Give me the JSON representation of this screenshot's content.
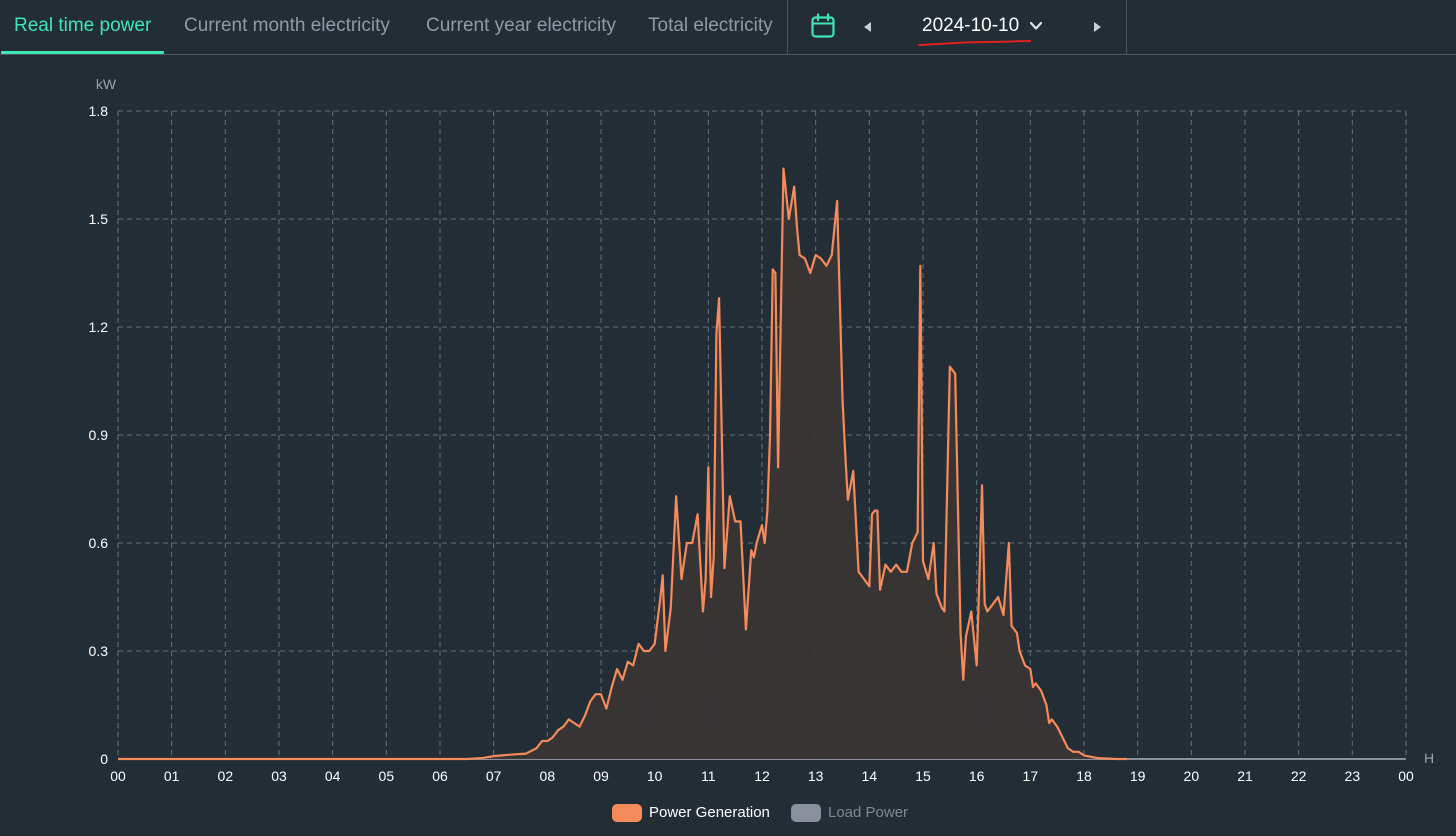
{
  "tabs": [
    {
      "label": "Real time power",
      "active": true
    },
    {
      "label": "Current month electricity",
      "active": false
    },
    {
      "label": "Current year electricity",
      "active": false
    },
    {
      "label": "Total electricity",
      "active": false
    }
  ],
  "date_picker": {
    "date": "2024-10-10",
    "calendar_icon": "calendar-icon",
    "prev_icon": "caret-left-icon",
    "next_icon": "caret-right-icon"
  },
  "colors": {
    "accent": "#3ee6b4",
    "generation": "#f58a5a",
    "load": "#8a8f9e",
    "background": "#222d36"
  },
  "chart_data": {
    "type": "area",
    "y_unit": "kW",
    "x_unit": "H",
    "ylim": [
      0,
      1.8
    ],
    "y_ticks": [
      "0",
      "0.3",
      "0.6",
      "0.9",
      "1.2",
      "1.5",
      "1.8"
    ],
    "x_ticks": [
      "00",
      "01",
      "02",
      "03",
      "04",
      "05",
      "06",
      "07",
      "08",
      "09",
      "10",
      "11",
      "12",
      "13",
      "14",
      "15",
      "16",
      "17",
      "18",
      "19",
      "20",
      "21",
      "22",
      "23",
      "00"
    ],
    "grid": true,
    "legend_position": "bottom-center",
    "series": [
      {
        "name": "Power Generation",
        "color": "#f58a5a",
        "x_hours": [
          0,
          6.5,
          6.8,
          7.0,
          7.3,
          7.6,
          7.8,
          7.9,
          8.0,
          8.1,
          8.2,
          8.3,
          8.4,
          8.5,
          8.6,
          8.7,
          8.8,
          8.9,
          9.0,
          9.1,
          9.2,
          9.3,
          9.4,
          9.5,
          9.6,
          9.7,
          9.8,
          9.9,
          10.0,
          10.1,
          10.15,
          10.2,
          10.3,
          10.4,
          10.5,
          10.6,
          10.7,
          10.8,
          10.9,
          10.95,
          11.0,
          11.05,
          11.1,
          11.15,
          11.2,
          11.3,
          11.4,
          11.5,
          11.6,
          11.7,
          11.8,
          11.85,
          11.9,
          12.0,
          12.05,
          12.1,
          12.15,
          12.2,
          12.25,
          12.3,
          12.4,
          12.5,
          12.6,
          12.65,
          12.7,
          12.8,
          12.9,
          13.0,
          13.1,
          13.2,
          13.3,
          13.4,
          13.5,
          13.55,
          13.6,
          13.7,
          13.8,
          13.85,
          13.9,
          14.0,
          14.05,
          14.1,
          14.15,
          14.2,
          14.3,
          14.4,
          14.5,
          14.6,
          14.7,
          14.8,
          14.9,
          14.95,
          15.0,
          15.1,
          15.2,
          15.25,
          15.3,
          15.35,
          15.4,
          15.5,
          15.55,
          15.6,
          15.7,
          15.75,
          15.8,
          15.9,
          16.0,
          16.05,
          16.1,
          16.15,
          16.2,
          16.3,
          16.4,
          16.5,
          16.6,
          16.65,
          16.7,
          16.75,
          16.8,
          16.9,
          17.0,
          17.05,
          17.1,
          17.2,
          17.3,
          17.35,
          17.4,
          17.5,
          17.6,
          17.7,
          17.8,
          17.9,
          18.0,
          18.1,
          18.2,
          18.3,
          18.6,
          18.8,
          19.0,
          24.0
        ],
        "values": [
          0,
          0,
          0.003,
          0.008,
          0.012,
          0.015,
          0.03,
          0.05,
          0.05,
          0.06,
          0.08,
          0.09,
          0.11,
          0.1,
          0.09,
          0.12,
          0.16,
          0.18,
          0.18,
          0.14,
          0.2,
          0.25,
          0.22,
          0.27,
          0.26,
          0.32,
          0.3,
          0.3,
          0.32,
          0.44,
          0.51,
          0.3,
          0.42,
          0.73,
          0.5,
          0.6,
          0.6,
          0.68,
          0.41,
          0.5,
          0.81,
          0.45,
          0.56,
          1.18,
          1.28,
          0.53,
          0.73,
          0.66,
          0.66,
          0.36,
          0.58,
          0.56,
          0.6,
          0.65,
          0.6,
          0.69,
          0.9,
          1.36,
          1.35,
          0.81,
          1.64,
          1.5,
          1.59,
          1.48,
          1.4,
          1.39,
          1.35,
          1.4,
          1.39,
          1.37,
          1.4,
          1.55,
          1.0,
          0.85,
          0.72,
          0.8,
          0.52,
          0.51,
          0.5,
          0.48,
          0.68,
          0.69,
          0.69,
          0.47,
          0.54,
          0.52,
          0.54,
          0.52,
          0.52,
          0.6,
          0.63,
          1.37,
          0.55,
          0.5,
          0.6,
          0.46,
          0.44,
          0.42,
          0.41,
          1.09,
          1.08,
          1.07,
          0.35,
          0.22,
          0.34,
          0.41,
          0.26,
          0.5,
          0.76,
          0.43,
          0.41,
          0.43,
          0.45,
          0.4,
          0.6,
          0.37,
          0.36,
          0.35,
          0.3,
          0.26,
          0.25,
          0.2,
          0.21,
          0.19,
          0.15,
          0.1,
          0.11,
          0.09,
          0.06,
          0.03,
          0.02,
          0.02,
          0.01,
          0.007,
          0.004,
          0.002,
          0,
          0
        ]
      },
      {
        "name": "Load Power",
        "color": "#8a8f9e",
        "x_hours": [
          0,
          24
        ],
        "values": [
          0,
          0
        ]
      }
    ]
  }
}
